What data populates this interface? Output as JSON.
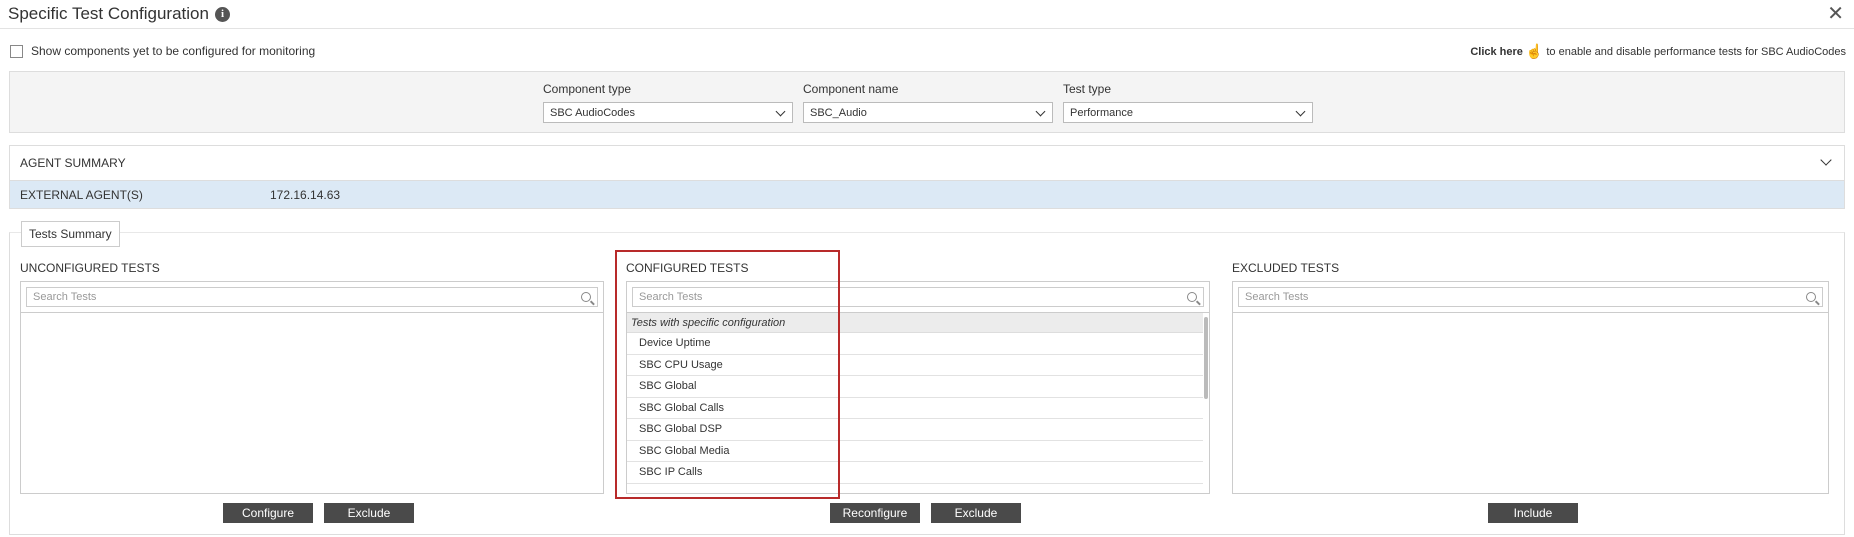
{
  "header": {
    "title": "Specific Test Configuration"
  },
  "show_components": {
    "label": "Show components yet to be configured for monitoring",
    "checked": false
  },
  "click_here": {
    "bold": "Click here",
    "rest": "to enable and disable performance tests for SBC AudioCodes"
  },
  "filters": {
    "component_type": {
      "label": "Component type",
      "value": "SBC AudioCodes"
    },
    "component_name": {
      "label": "Component name",
      "value": "SBC_Audio"
    },
    "test_type": {
      "label": "Test type",
      "value": "Performance"
    }
  },
  "agent_summary": {
    "title": "AGENT SUMMARY",
    "row_label": "EXTERNAL AGENT(S)",
    "row_value": "172.16.14.63"
  },
  "tests_summary": {
    "tab_label": "Tests Summary",
    "unconfigured": {
      "title": "UNCONFIGURED TESTS",
      "placeholder": "Search Tests"
    },
    "configured": {
      "title": "CONFIGURED TESTS",
      "placeholder": "Search Tests",
      "group_label": "Tests with specific configuration",
      "items": [
        "Device Uptime",
        "SBC CPU Usage",
        "SBC Global",
        "SBC Global Calls",
        "SBC Global DSP",
        "SBC Global Media",
        "SBC IP Calls"
      ]
    },
    "excluded": {
      "title": "EXCLUDED TESTS",
      "placeholder": "Search Tests"
    }
  },
  "buttons": {
    "configure": "Configure",
    "exclude_left": "Exclude",
    "reconfigure": "Reconfigure",
    "exclude_mid": "Exclude",
    "include": "Include"
  },
  "colors": {
    "highlight": "#b82a2a",
    "agent_row_bg": "#dce9f5",
    "button_bg": "#4a4a4a"
  }
}
